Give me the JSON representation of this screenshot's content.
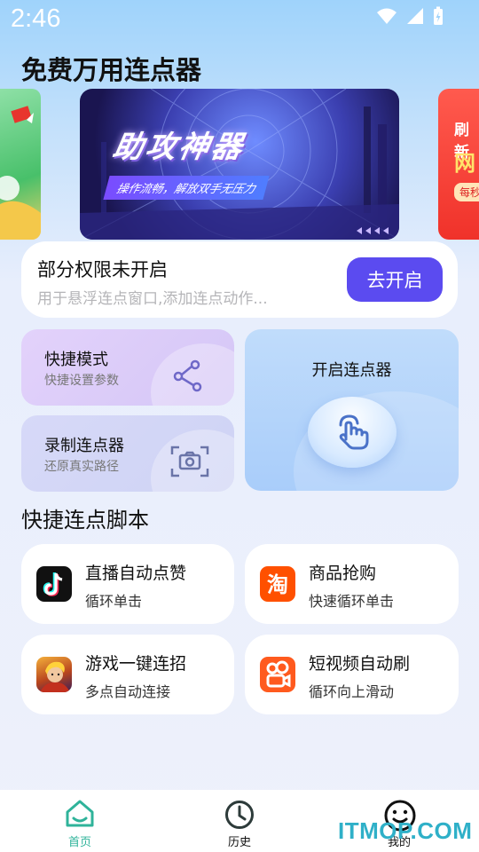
{
  "status_bar": {
    "time": "2:46"
  },
  "app": {
    "title": "免费万用连点器"
  },
  "banner": {
    "headline": "助攻神器",
    "subline": "操作流畅，解放双手无压力",
    "right_text1": "刷新",
    "right_text2": "网",
    "right_text3": "每秒"
  },
  "permission": {
    "title": "部分权限未开启",
    "desc": "用于悬浮连点窗口,添加连点动作...",
    "button": "去开启"
  },
  "modes": {
    "quick": {
      "title": "快捷模式",
      "sub": "快捷设置参数"
    },
    "record": {
      "title": "录制连点器",
      "sub": "还原真实路径"
    },
    "start": {
      "title": "开启连点器"
    }
  },
  "scripts": {
    "heading": "快捷连点脚本",
    "items": [
      {
        "title": "直播自动点赞",
        "sub": "循环单击",
        "icon": "tiktok-icon"
      },
      {
        "title": "商品抢购",
        "sub": "快速循环单击",
        "icon": "taobao-icon"
      },
      {
        "title": "游戏一键连招",
        "sub": "多点自动连接",
        "icon": "game-hero-icon"
      },
      {
        "title": "短视频自动刷",
        "sub": "循环向上滑动",
        "icon": "kuaishou-icon"
      }
    ]
  },
  "tabbar": {
    "tabs": [
      {
        "label": "首页",
        "icon": "home-icon",
        "active": true
      },
      {
        "label": "历史",
        "icon": "clock-icon",
        "active": false
      },
      {
        "label": "我的",
        "icon": "smile-icon",
        "active": false
      }
    ]
  },
  "watermark": "ITMOP.COM",
  "colors": {
    "accent": "#5b4bf0",
    "active_tab": "#2fb39a",
    "brand_green": "#21a88e"
  }
}
